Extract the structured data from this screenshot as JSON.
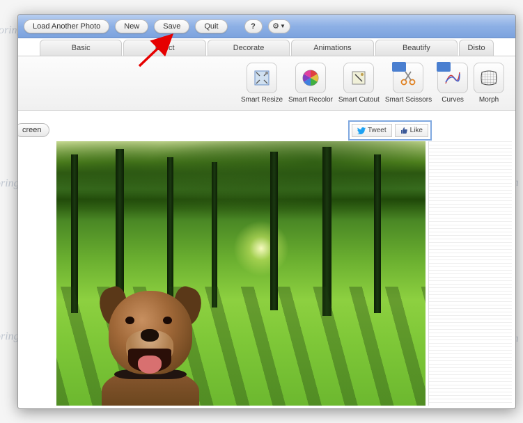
{
  "toolbar": {
    "load_another": "Load Another Photo",
    "new": "New",
    "save": "Save",
    "quit": "Quit",
    "help": "?",
    "gear": "⚙"
  },
  "tabs": [
    "Basic",
    "Effect",
    "Decorate",
    "Animations",
    "Beautify",
    "Disto"
  ],
  "tools": [
    {
      "label": "Smart Resize",
      "icon": "resize-icon"
    },
    {
      "label": "Smart Recolor",
      "icon": "recolor-icon"
    },
    {
      "label": "Smart Cutout",
      "icon": "cutout-icon"
    },
    {
      "label": "Smart Scissors",
      "icon": "scissors-icon"
    },
    {
      "label": "Curves",
      "icon": "curves-icon"
    },
    {
      "label": "Morph",
      "icon": "morph-icon"
    }
  ],
  "side": {
    "screen": "creen"
  },
  "social": {
    "tweet": "Tweet",
    "like": "Like"
  },
  "watermark": "Soringperepair.Com",
  "colors": {
    "accent": "#8db0e5",
    "highlight": "#7fa8e0",
    "arrow": "#e60000"
  }
}
